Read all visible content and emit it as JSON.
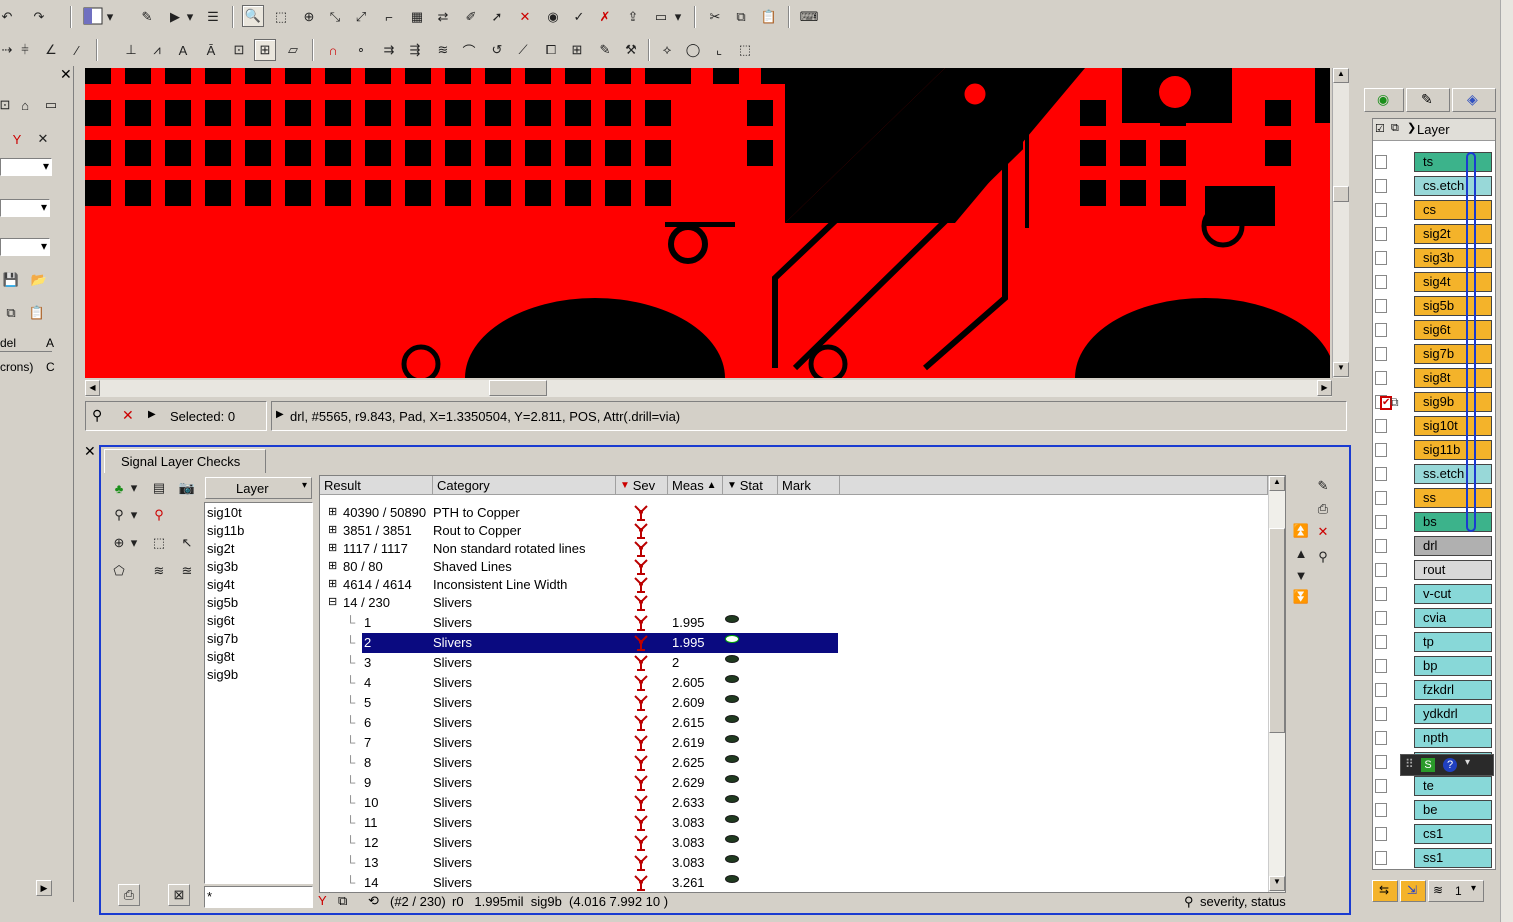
{
  "selection_bar": {
    "selected_label": "Selected: 0",
    "info": "drl, #5565, r9.843, Pad, X=1.3350504, Y=2.811, POS, Attr(.drill=via)"
  },
  "left_panel": {
    "tab_partial": "del",
    "tab_partial2": "A",
    "units_partial": "crons)",
    "units_partial2": "C"
  },
  "checks_panel": {
    "tab_label": "Signal Layer Checks",
    "layer_dropdown": "Layer",
    "filter_value": "*",
    "layers": [
      "sig10t",
      "sig11b",
      "sig2t",
      "sig3b",
      "sig4t",
      "sig5b",
      "sig6t",
      "sig7b",
      "sig8t",
      "sig9b"
    ],
    "columns": {
      "result": "Result",
      "category": "Category",
      "sev": "Sev",
      "meas": "Meas",
      "stat": "Stat",
      "mark": "Mark"
    },
    "groups": [
      {
        "result": "40390 / 50890",
        "category": "PTH to Copper"
      },
      {
        "result": "3851 / 3851",
        "category": "Rout to Copper"
      },
      {
        "result": "1117 / 1117",
        "category": "Non standard rotated lines"
      },
      {
        "result": "80 / 80",
        "category": "Shaved Lines"
      },
      {
        "result": "4614 / 4614",
        "category": "Inconsistent Line Width"
      },
      {
        "result": "14 / 230",
        "category": "Slivers"
      }
    ],
    "items": [
      {
        "result": "1",
        "category": "Slivers",
        "meas": "1.995"
      },
      {
        "result": "2",
        "category": "Slivers",
        "meas": "1.995"
      },
      {
        "result": "3",
        "category": "Slivers",
        "meas": "2"
      },
      {
        "result": "4",
        "category": "Slivers",
        "meas": "2.605"
      },
      {
        "result": "5",
        "category": "Slivers",
        "meas": "2.609"
      },
      {
        "result": "6",
        "category": "Slivers",
        "meas": "2.615"
      },
      {
        "result": "7",
        "category": "Slivers",
        "meas": "2.619"
      },
      {
        "result": "8",
        "category": "Slivers",
        "meas": "2.625"
      },
      {
        "result": "9",
        "category": "Slivers",
        "meas": "2.629"
      },
      {
        "result": "10",
        "category": "Slivers",
        "meas": "2.633"
      },
      {
        "result": "11",
        "category": "Slivers",
        "meas": "3.083"
      },
      {
        "result": "12",
        "category": "Slivers",
        "meas": "3.083"
      },
      {
        "result": "13",
        "category": "Slivers",
        "meas": "3.083"
      },
      {
        "result": "14",
        "category": "Slivers",
        "meas": "3.261"
      }
    ],
    "status_bar": {
      "position": "(#2 / 230)",
      "info": "r0   1.995mil  sig9b  (4.016 7.992 10 )",
      "filter": "severity, status"
    }
  },
  "layers_panel": {
    "header": "Layer",
    "layers": [
      {
        "name": "ts",
        "color": "#3cb38b"
      },
      {
        "name": "cs.etch",
        "color": "#98d8d8"
      },
      {
        "name": "cs",
        "color": "#f4b32a"
      },
      {
        "name": "sig2t",
        "color": "#f4b32a"
      },
      {
        "name": "sig3b",
        "color": "#f4b32a"
      },
      {
        "name": "sig4t",
        "color": "#f4b32a"
      },
      {
        "name": "sig5b",
        "color": "#f4b32a"
      },
      {
        "name": "sig6t",
        "color": "#f4b32a"
      },
      {
        "name": "sig7b",
        "color": "#f4b32a"
      },
      {
        "name": "sig8t",
        "color": "#f4b32a"
      },
      {
        "name": "sig9b",
        "color": "#f4b32a"
      },
      {
        "name": "sig10t",
        "color": "#f4b32a"
      },
      {
        "name": "sig11b",
        "color": "#f4b32a"
      },
      {
        "name": "ss.etch",
        "color": "#98d8d8"
      },
      {
        "name": "ss",
        "color": "#f4b32a"
      },
      {
        "name": "bs",
        "color": "#3cb38b"
      },
      {
        "name": "drl",
        "color": "#b0b0b0"
      },
      {
        "name": "rout",
        "color": "#d8d8d8"
      },
      {
        "name": "v-cut",
        "color": "#88d8d8"
      },
      {
        "name": "cvia",
        "color": "#88d8d8"
      },
      {
        "name": "tp",
        "color": "#88d8d8"
      },
      {
        "name": "bp",
        "color": "#88d8d8"
      },
      {
        "name": "fzkdrl",
        "color": "#88d8d8"
      },
      {
        "name": "ydkdrl",
        "color": "#88d8d8"
      },
      {
        "name": "npth",
        "color": "#88d8d8"
      },
      {
        "name": "",
        "color": "#88d8d8"
      },
      {
        "name": "te",
        "color": "#88d8d8"
      },
      {
        "name": "be",
        "color": "#88d8d8"
      },
      {
        "name": "cs1",
        "color": "#88d8d8"
      },
      {
        "name": "ss1",
        "color": "#88d8d8"
      }
    ],
    "bottom_count": "1"
  },
  "colors": {
    "canvas_bg": "#ff0000",
    "selection": "#0a0a80",
    "panel_border": "#1a3bd1"
  }
}
